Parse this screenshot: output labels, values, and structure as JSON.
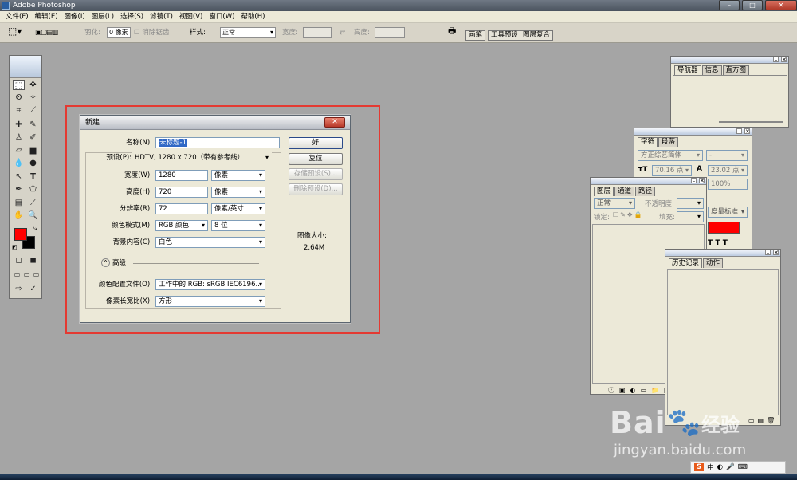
{
  "app": {
    "title": "Adobe Photoshop"
  },
  "menu": [
    "文件(F)",
    "编辑(E)",
    "图像(I)",
    "图层(L)",
    "选择(S)",
    "滤镜(T)",
    "视图(V)",
    "窗口(W)",
    "帮助(H)"
  ],
  "options": {
    "feather_label": "羽化:",
    "feather_value": "0 像素",
    "antialias_label": "消除锯齿",
    "style_label": "样式:",
    "style_value": "正常",
    "width_label": "宽度:",
    "height_label": "高度:",
    "palette_tabs": [
      "画笔",
      "工具预设",
      "图层复合"
    ]
  },
  "dialog": {
    "title": "新建",
    "name_label": "名称(N):",
    "name_value": "未标题-1",
    "preset_label": "预设(P):",
    "preset_value": "HDTV, 1280 x 720（带有参考线）",
    "width_label": "宽度(W):",
    "width_value": "1280",
    "width_unit": "像素",
    "height_label": "高度(H):",
    "height_value": "720",
    "height_unit": "像素",
    "resolution_label": "分辨率(R):",
    "resolution_value": "72",
    "resolution_unit": "像素/英寸",
    "color_mode_label": "颜色模式(M):",
    "color_mode_value": "RGB 颜色",
    "bit_depth_value": "8 位",
    "background_label": "背景内容(C):",
    "background_value": "白色",
    "advanced_label": "高级",
    "color_profile_label": "颜色配置文件(O):",
    "color_profile_value": "工作中的 RGB: sRGB IEC6196...",
    "pixel_aspect_label": "像素长宽比(X):",
    "pixel_aspect_value": "方形",
    "ok_button": "好",
    "reset_button": "复位",
    "save_preset_button": "存储预设(S)...",
    "delete_preset_button": "删除预设(D)...",
    "image_size_label": "图像大小:",
    "image_size_value": "2.64M"
  },
  "navigator_panel": {
    "tabs": [
      "导航器",
      "信息",
      "直方图"
    ]
  },
  "character_panel": {
    "tabs": [
      "字符",
      "段落"
    ],
    "font_value": "方正综艺简体",
    "style_value": "-",
    "size_value": "70.16 点",
    "leading_value": "23.02 点",
    "scale_value": "100%",
    "measure_value": "度量标准",
    "color_hex": "#ff0000"
  },
  "layers_panel": {
    "tabs": [
      "图层",
      "通道",
      "路径"
    ],
    "blend_value": "正常",
    "opacity_label": "不透明度:",
    "lock_label": "锁定:",
    "fill_label": "填充:"
  },
  "history_panel": {
    "tabs": [
      "历史记录",
      "动作"
    ]
  },
  "watermark": {
    "line1": "Bai",
    "line2": "经验",
    "line3": "jingyan.baidu.com"
  },
  "tray": [
    "S",
    "中",
    "◐",
    "🎤",
    "⌨"
  ],
  "colors": {
    "foreground": "#ff0000",
    "background": "#000000",
    "highlight": "#e43a32"
  }
}
